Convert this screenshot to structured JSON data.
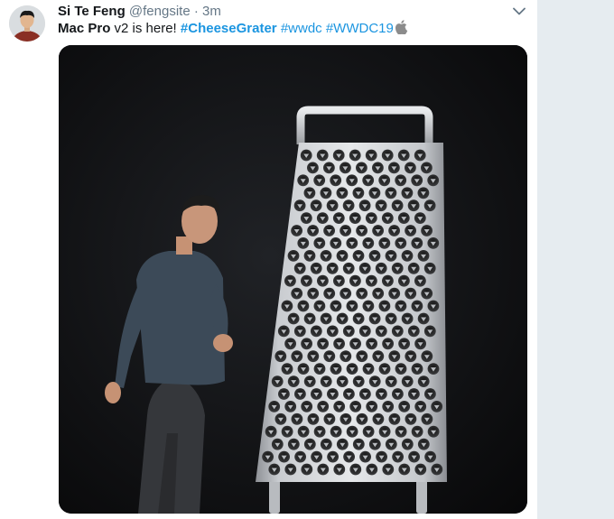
{
  "tweet": {
    "author_name": "Si Te Feng",
    "author_handle": "@fengsite",
    "separator": "·",
    "timestamp": "3m",
    "text": {
      "bold_part": "Mac Pro",
      "plain_part": " v2 is here! ",
      "hashtags": [
        "#CheeseGrater",
        "#wwdc",
        "#WWDC19"
      ],
      "trailing_icon": "apple-logo-icon"
    },
    "menu_icon": "chevron-down-icon"
  },
  "colors": {
    "link": "#1b95e0",
    "name": "#14171a",
    "meta": "#657786",
    "background": "#e6ecf0"
  }
}
